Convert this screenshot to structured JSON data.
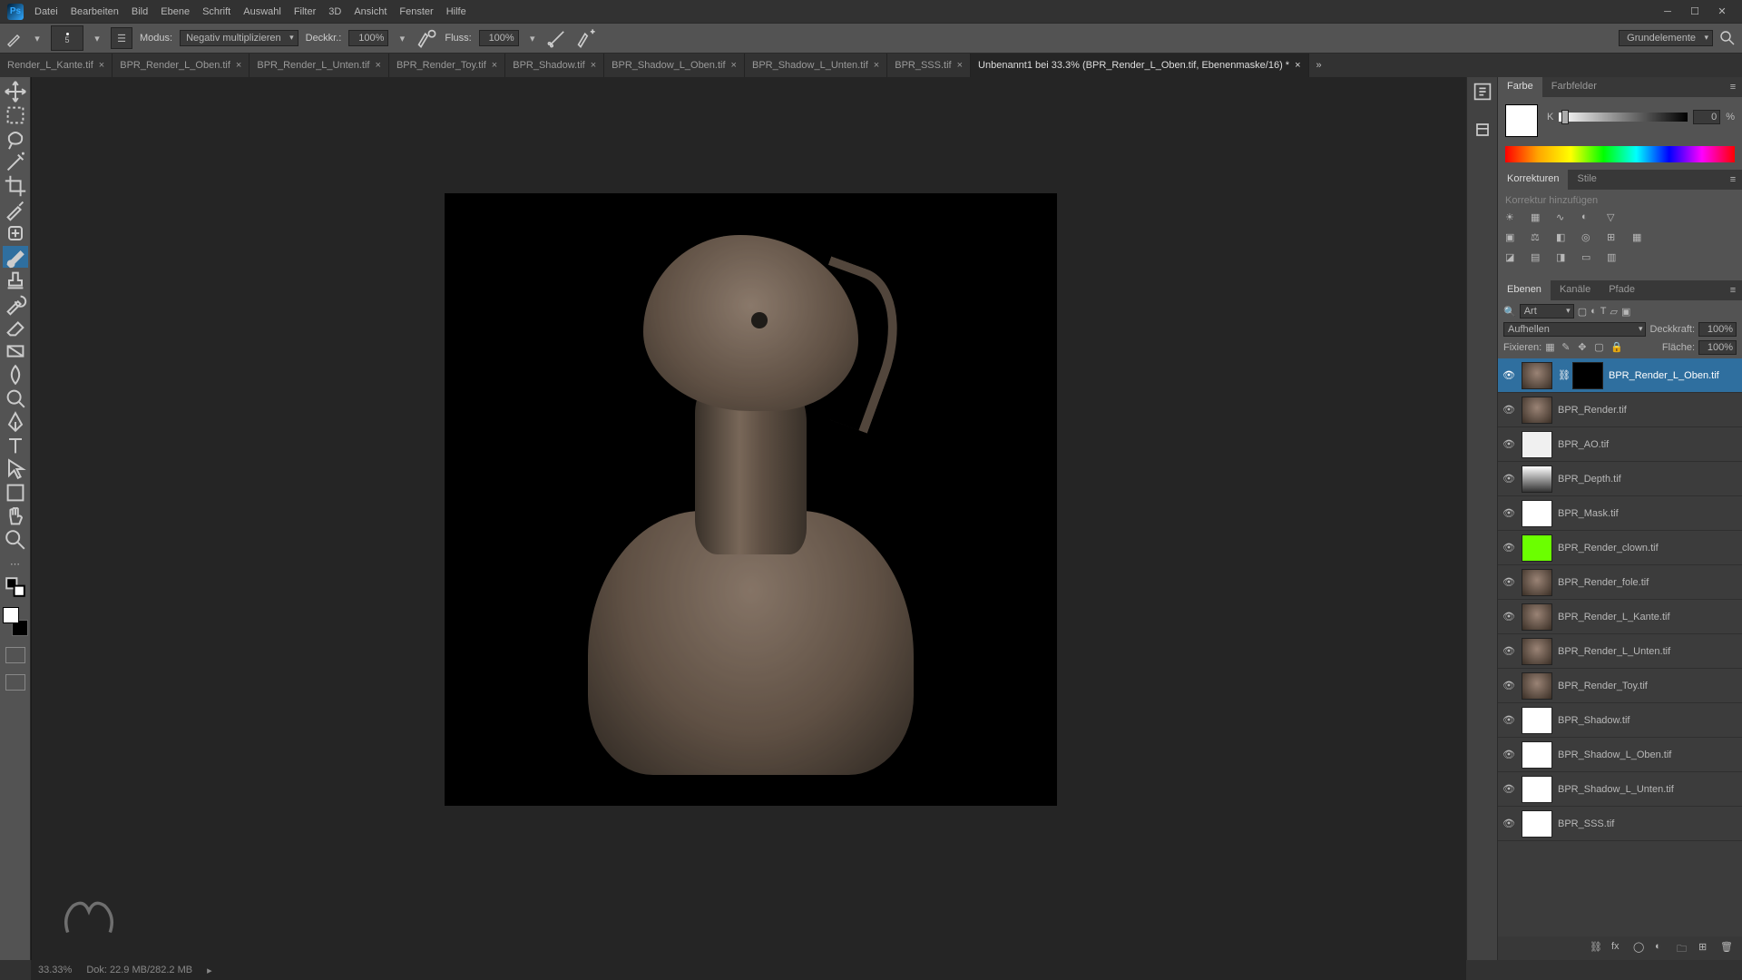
{
  "app": {
    "logo_text": "Ps"
  },
  "menu": [
    "Datei",
    "Bearbeiten",
    "Bild",
    "Ebene",
    "Schrift",
    "Auswahl",
    "Filter",
    "3D",
    "Ansicht",
    "Fenster",
    "Hilfe"
  ],
  "options_bar": {
    "brush_size": "5",
    "mode_label": "Modus:",
    "mode_value": "Negativ multiplizieren",
    "opacity_label": "Deckkr.:",
    "opacity_value": "100%",
    "flow_label": "Fluss:",
    "flow_value": "100%",
    "workspace": "Grundelemente"
  },
  "tabs": [
    {
      "label": "Render_L_Kante.tif",
      "active": false
    },
    {
      "label": "BPR_Render_L_Oben.tif",
      "active": false
    },
    {
      "label": "BPR_Render_L_Unten.tif",
      "active": false
    },
    {
      "label": "BPR_Render_Toy.tif",
      "active": false
    },
    {
      "label": "BPR_Shadow.tif",
      "active": false
    },
    {
      "label": "BPR_Shadow_L_Oben.tif",
      "active": false
    },
    {
      "label": "BPR_Shadow_L_Unten.tif",
      "active": false
    },
    {
      "label": "BPR_SSS.tif",
      "active": false
    },
    {
      "label": "Unbenannt1 bei 33.3% (BPR_Render_L_Oben.tif, Ebenenmaske/16) *",
      "active": true
    }
  ],
  "panels": {
    "color": {
      "tabs": [
        "Farbe",
        "Farbfelder"
      ],
      "channel": "K",
      "value": "0",
      "pct": "%"
    },
    "adjustments": {
      "tabs": [
        "Korrekturen",
        "Stile"
      ],
      "hint": "Korrektur hinzufügen"
    },
    "layers": {
      "tabs": [
        "Ebenen",
        "Kanäle",
        "Pfade"
      ],
      "filter_label": "Art",
      "blend_mode": "Aufhellen",
      "opacity_label": "Deckkraft:",
      "opacity_value": "100%",
      "lock_label": "Fixieren:",
      "fill_label": "Fläche:",
      "fill_value": "100%",
      "items": [
        {
          "name": "BPR_Render_L_Oben.tif",
          "selected": true,
          "thumb": "render",
          "mask": true
        },
        {
          "name": "BPR_Render.tif",
          "thumb": "render"
        },
        {
          "name": "BPR_AO.tif",
          "thumb": "ao"
        },
        {
          "name": "BPR_Depth.tif",
          "thumb": "depth"
        },
        {
          "name": "BPR_Mask.tif",
          "thumb": "white"
        },
        {
          "name": "BPR_Render_clown.tif",
          "thumb": "green"
        },
        {
          "name": "BPR_Render_fole.tif",
          "thumb": "render"
        },
        {
          "name": "BPR_Render_L_Kante.tif",
          "thumb": "render"
        },
        {
          "name": "BPR_Render_L_Unten.tif",
          "thumb": "render"
        },
        {
          "name": "BPR_Render_Toy.tif",
          "thumb": "render"
        },
        {
          "name": "BPR_Shadow.tif",
          "thumb": "white"
        },
        {
          "name": "BPR_Shadow_L_Oben.tif",
          "thumb": "white"
        },
        {
          "name": "BPR_Shadow_L_Unten.tif",
          "thumb": "white"
        },
        {
          "name": "BPR_SSS.tif",
          "thumb": "white"
        }
      ]
    }
  },
  "status": {
    "zoom": "33.33%",
    "doc": "Dok: 22.9 MB/282.2 MB"
  }
}
